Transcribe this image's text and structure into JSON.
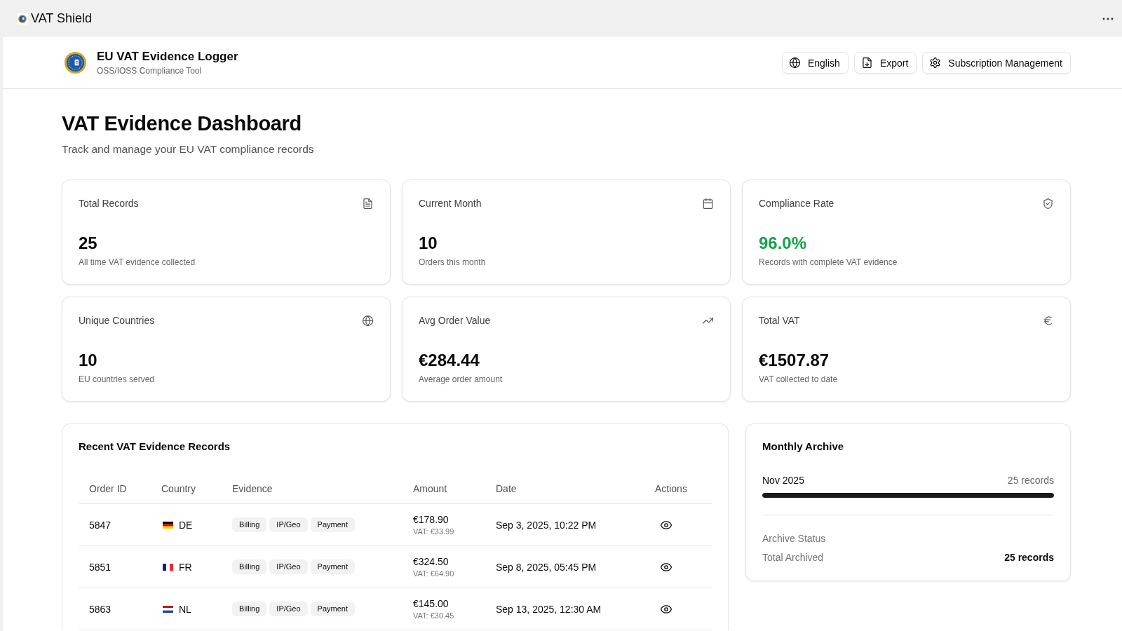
{
  "app_bar": {
    "title": "VAT Shield"
  },
  "header": {
    "title": "EU VAT Evidence Logger",
    "subtitle": "OSS/IOSS Compliance Tool",
    "buttons": [
      "English",
      "Export",
      "Subscription Management"
    ]
  },
  "dashboard": {
    "title": "VAT Evidence Dashboard",
    "subtitle": "Track and manage your EU VAT compliance records"
  },
  "stats": [
    {
      "label": "Total Records",
      "value": "25",
      "description": "All time VAT evidence collected",
      "color": "#0a0a0a"
    },
    {
      "label": "Current Month",
      "value": "10",
      "description": "Orders this month",
      "color": "#0a0a0a"
    },
    {
      "label": "Compliance Rate",
      "value": "96.0%",
      "description": "Records with complete VAT evidence",
      "color": "#16a34a"
    },
    {
      "label": "Unique Countries",
      "value": "10",
      "description": "EU countries served",
      "color": "#0a0a0a"
    },
    {
      "label": "Avg Order Value",
      "value": "€284.44",
      "description": "Average order amount",
      "color": "#0a0a0a"
    },
    {
      "label": "Total VAT",
      "value": "€1507.87",
      "description": "VAT collected to date",
      "color": "#0a0a0a"
    }
  ],
  "records": {
    "title": "Recent VAT Evidence Records",
    "columns": [
      "Order ID",
      "Country",
      "Evidence",
      "Amount",
      "Date",
      "Actions"
    ],
    "rows": [
      {
        "order_id": "5847",
        "country": "DE",
        "evidence": [
          "Billing",
          "IP/Geo",
          "Payment"
        ],
        "amount": "€178.90",
        "vat": "VAT: €33.99",
        "date": "Sep 3, 2025, 10:22 PM"
      },
      {
        "order_id": "5851",
        "country": "FR",
        "evidence": [
          "Billing",
          "IP/Geo",
          "Payment"
        ],
        "amount": "€324.50",
        "vat": "VAT: €64.90",
        "date": "Sep 8, 2025, 05:45 PM"
      },
      {
        "order_id": "5863",
        "country": "NL",
        "evidence": [
          "Billing",
          "IP/Geo",
          "Payment"
        ],
        "amount": "€145.00",
        "vat": "VAT: €30.45",
        "date": "Sep 13, 2025, 12:30 AM"
      }
    ]
  },
  "archive": {
    "title": "Monthly Archive",
    "months": [
      {
        "label": "Nov 2025",
        "count": "25 records",
        "level": 1.0
      }
    ],
    "status_title": "Archive Status",
    "total_label": "Total Archived",
    "total_value": "25 records"
  }
}
